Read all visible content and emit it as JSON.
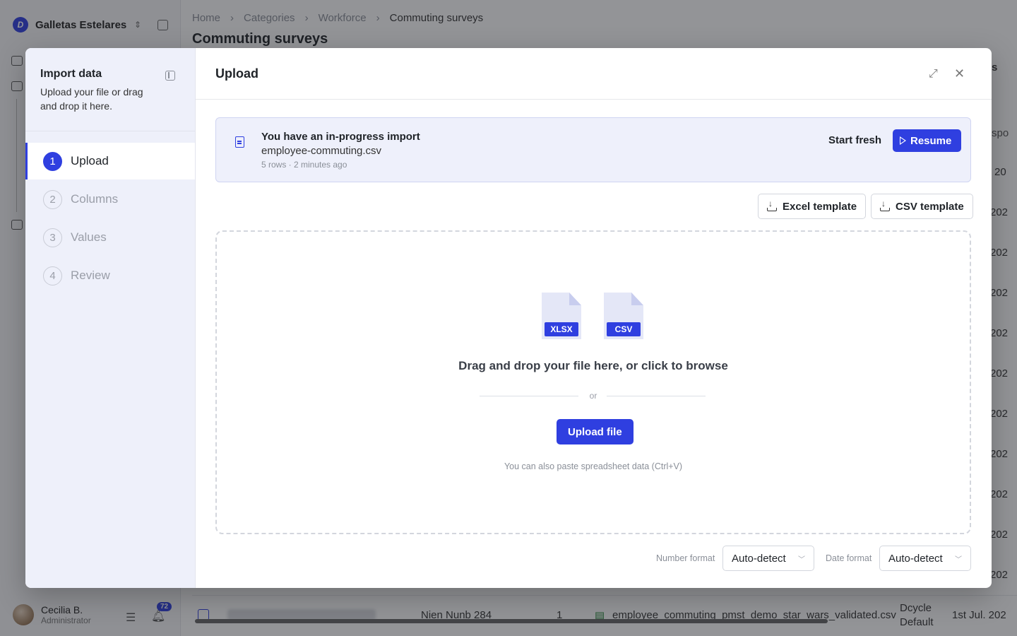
{
  "org": {
    "name": "Galletas Estelares",
    "logo_letter": "D"
  },
  "user": {
    "name": "Cecilia B.",
    "role": "Administrator",
    "notifications": "72"
  },
  "breadcrumb": [
    "Home",
    "Categories",
    "Workforce",
    "Commuting surveys"
  ],
  "page_title": "Commuting surveys",
  "background_row": {
    "name": "Nien Nunb 284",
    "count": "1",
    "file": "employee_commuting_pmst_demo_star_wars_validated.csv",
    "source_line1": "Dcycle",
    "source_line2": "Default",
    "date": "1st Jul. 202"
  },
  "background_fragments": {
    "header_tab": "s",
    "col_header": "spo",
    "year_first": "20",
    "year": "202"
  },
  "modal": {
    "sidebar_title": "Import data",
    "sidebar_subtitle": "Upload your file or drag and drop it here.",
    "steps": [
      {
        "number": "1",
        "label": "Upload"
      },
      {
        "number": "2",
        "label": "Columns"
      },
      {
        "number": "3",
        "label": "Values"
      },
      {
        "number": "4",
        "label": "Review"
      }
    ],
    "title": "Upload",
    "banner": {
      "title": "You have an in-progress import",
      "file": "employee-commuting.csv",
      "meta": "5 rows · 2 minutes ago",
      "start_fresh": "Start fresh",
      "resume": "Resume"
    },
    "excel_template": "Excel template",
    "csv_template": "CSV template",
    "dropzone": {
      "xlsx_tag": "XLSX",
      "csv_tag": "CSV",
      "main_text": "Drag and drop your file here, or click to browse",
      "or": "or",
      "upload_button": "Upload file",
      "hint": "You can also paste spreadsheet data (Ctrl+V)"
    },
    "number_format": {
      "label": "Number format",
      "value": "Auto-detect"
    },
    "date_format": {
      "label": "Date format",
      "value": "Auto-detect"
    }
  }
}
